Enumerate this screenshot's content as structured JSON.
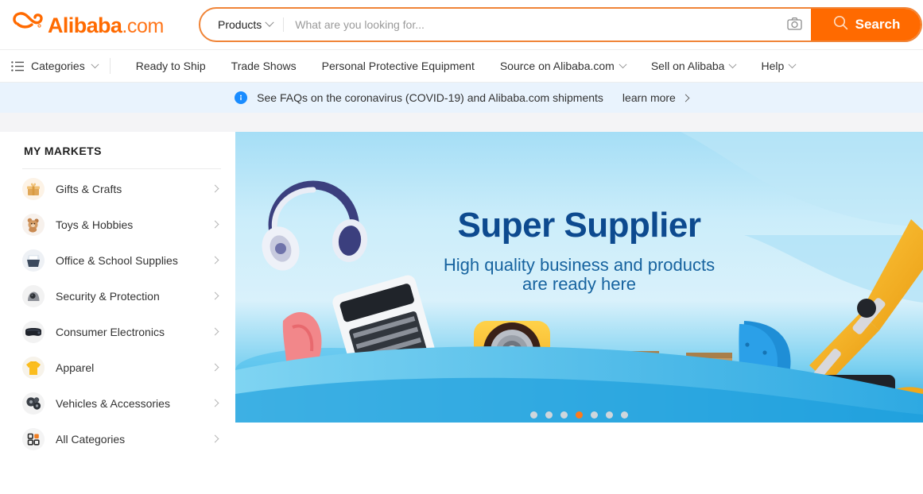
{
  "brand": {
    "name": "Alibaba",
    "suffix": ".com",
    "accent_color": "#ff6a00",
    "logo_icon": "alibaba-swirl-icon"
  },
  "search": {
    "category_label": "Products",
    "category_chevron_icon": "chevron-down-icon",
    "placeholder": "What are you looking for...",
    "value": "",
    "camera_icon": "camera-icon",
    "search_icon": "search-icon",
    "button_label": "Search"
  },
  "nav": {
    "categories_label": "Categories",
    "categories_icon": "list-icon",
    "items": [
      {
        "label": "Ready to Ship",
        "has_chevron": false
      },
      {
        "label": "Trade Shows",
        "has_chevron": false
      },
      {
        "label": "Personal Protective Equipment",
        "has_chevron": false
      },
      {
        "label": "Source on Alibaba.com",
        "has_chevron": true
      },
      {
        "label": "Sell on Alibaba",
        "has_chevron": true
      },
      {
        "label": "Help",
        "has_chevron": true
      }
    ]
  },
  "notice": {
    "icon": "info-circle-icon",
    "text": "See FAQs on the coronavirus (COVID-19) and Alibaba.com shipments",
    "link_label": "learn more",
    "link_icon": "chevron-right-icon",
    "background_color": "#e9f3fd"
  },
  "sidebar": {
    "title": "MY MARKETS",
    "items": [
      {
        "label": "Gifts & Crafts",
        "icon": "gift-icon",
        "arrow_icon": "chevron-right-icon"
      },
      {
        "label": "Toys & Hobbies",
        "icon": "teddy-bear-icon",
        "arrow_icon": "chevron-right-icon"
      },
      {
        "label": "Office & School Supplies",
        "icon": "printer-icon",
        "arrow_icon": "chevron-right-icon"
      },
      {
        "label": "Security & Protection",
        "icon": "cctv-camera-icon",
        "arrow_icon": "chevron-right-icon"
      },
      {
        "label": "Consumer Electronics",
        "icon": "vr-headset-icon",
        "arrow_icon": "chevron-right-icon"
      },
      {
        "label": "Apparel",
        "icon": "tshirt-icon",
        "arrow_icon": "chevron-right-icon"
      },
      {
        "label": "Vehicles & Accessories",
        "icon": "gears-icon",
        "arrow_icon": "chevron-right-icon"
      },
      {
        "label": "All Categories",
        "icon": "grid-squares-icon",
        "arrow_icon": "chevron-right-icon"
      }
    ]
  },
  "hero": {
    "title": "Super Supplier",
    "subtitle_line1": "High quality business and products",
    "subtitle_line2": "are ready here",
    "title_color": "#0d4a8f",
    "subtitle_color": "#17639f",
    "carousel": {
      "total_dots": 7,
      "active_index": 3,
      "active_color": "#ff7a1a",
      "inactive_color": "#cfd6dc"
    }
  }
}
